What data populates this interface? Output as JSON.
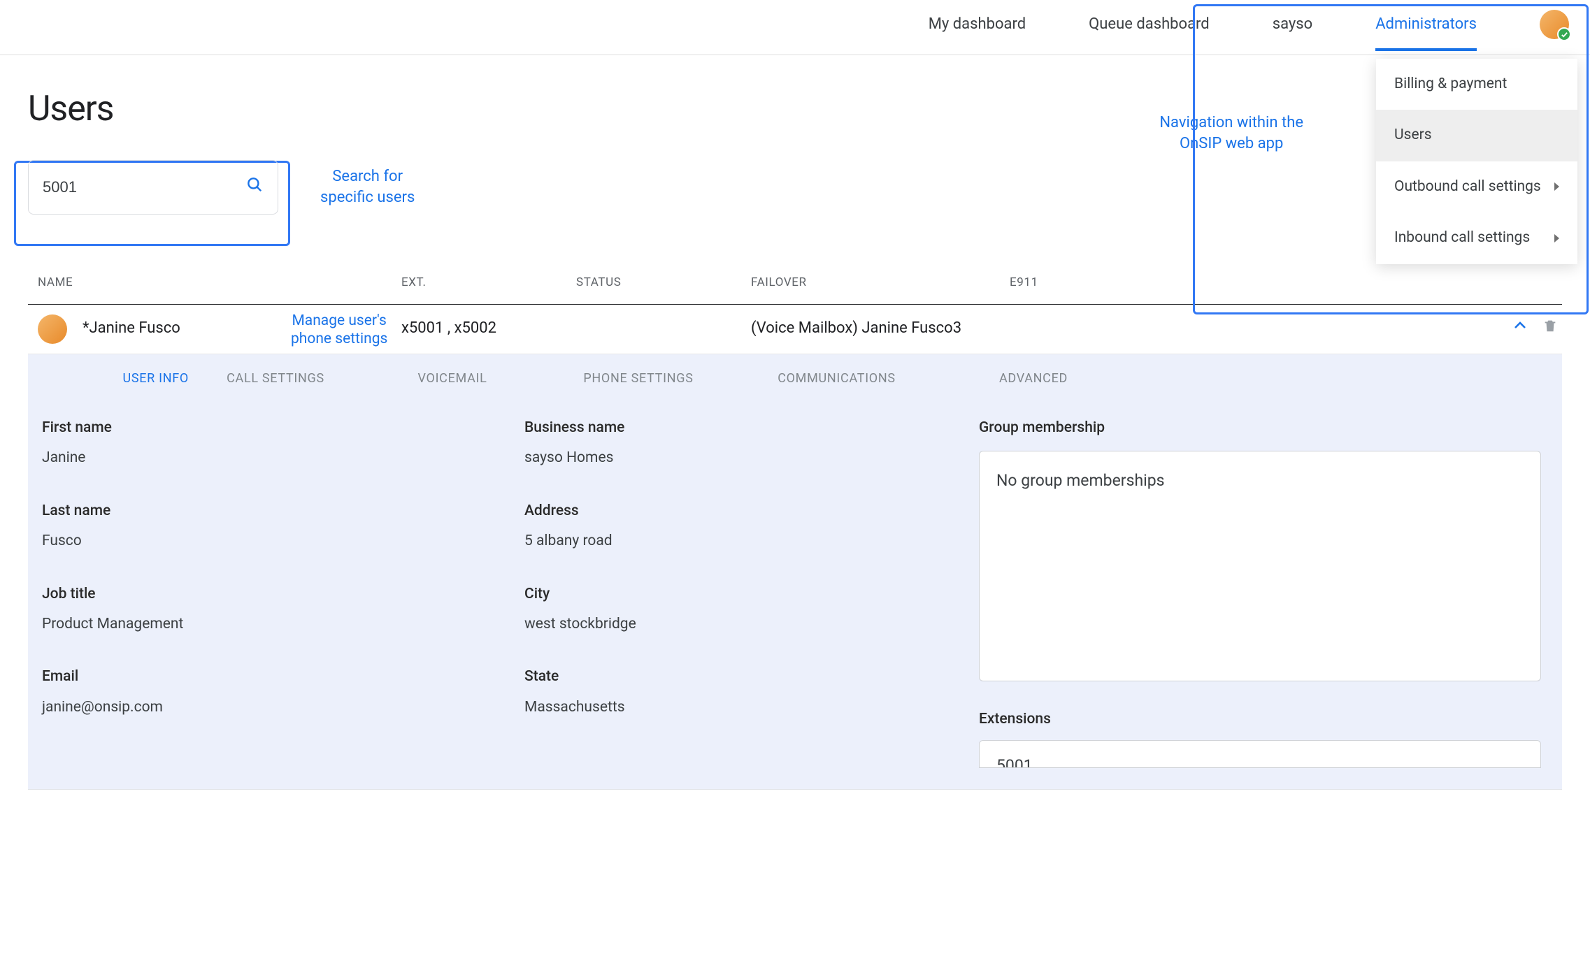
{
  "nav": {
    "items": [
      "My dashboard",
      "Queue dashboard",
      "sayso",
      "Administrators"
    ],
    "active_index": 3
  },
  "dropdown": {
    "items": [
      {
        "label": "Billing & payment",
        "has_arrow": false
      },
      {
        "label": "Users",
        "has_arrow": false
      },
      {
        "label": "Outbound call settings",
        "has_arrow": true
      },
      {
        "label": "Inbound call settings",
        "has_arrow": true
      }
    ],
    "selected_index": 1
  },
  "page": {
    "title": "Users"
  },
  "search": {
    "value": "5001"
  },
  "callouts": {
    "search": "Search for\nspecific users",
    "nav": "Navigation within the\nOnSIP web app",
    "row": "Manage user's\nphone settings"
  },
  "table": {
    "columns": [
      "NAME",
      "EXT.",
      "STATUS",
      "FAILOVER",
      "E911",
      ""
    ],
    "row": {
      "name": "*Janine Fusco",
      "ext": "x5001 ,  x5002",
      "status": "",
      "failover": "(Voice Mailbox) Janine Fusco3",
      "e911": ""
    }
  },
  "tabs": [
    "USER INFO",
    "CALL SETTINGS",
    "VOICEMAIL",
    "PHONE SETTINGS",
    "COMMUNICATIONS",
    "ADVANCED"
  ],
  "detail": {
    "first_name": {
      "label": "First name",
      "value": "Janine"
    },
    "last_name": {
      "label": "Last name",
      "value": "Fusco"
    },
    "job_title": {
      "label": "Job title",
      "value": "Product Management"
    },
    "email": {
      "label": "Email",
      "value": "janine@onsip.com"
    },
    "business_name": {
      "label": "Business name",
      "value": "sayso Homes"
    },
    "address": {
      "label": "Address",
      "value": "5 albany road"
    },
    "city": {
      "label": "City",
      "value": "west stockbridge"
    },
    "state": {
      "label": "State",
      "value": "Massachusetts"
    },
    "group": {
      "label": "Group membership",
      "empty_text": "No group memberships"
    },
    "extensions": {
      "label": "Extensions",
      "value_preview": "5001"
    }
  }
}
